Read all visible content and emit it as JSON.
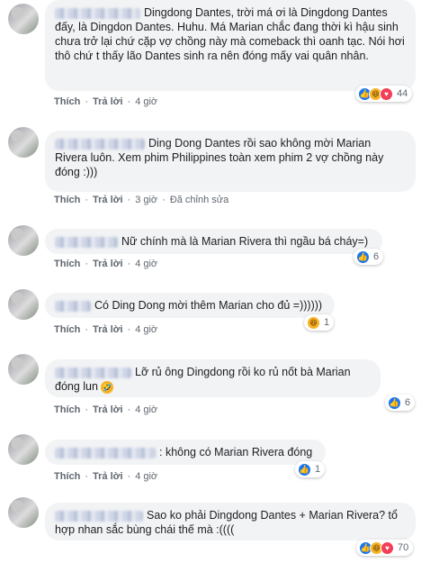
{
  "comments": [
    {
      "text": "Dingdong Dantes, trời má ơi là Dingdong Dantes đấy, là Dingdon Dantes. Huhu. Má Marian chắc đang thời kì hậu sinh chưa trở lại chứ cặp vợ chồng này mà comeback thì oanh tạc. Nói hơi thô chứ t thấy lão Dantes sinh ra nên đóng mấy vai quân nhân.",
      "like": "Thích",
      "reply": "Trả lời",
      "time": "4 giờ",
      "edited": "",
      "reactions": [
        "like-icon",
        "haha-icon",
        "love-icon"
      ],
      "reaction_count": "44"
    },
    {
      "text": "Ding Dong Dantes rồi sao không mời Marian Rivera luôn. Xem phim Philippines toàn xem phim 2 vợ chồng này đóng :)))",
      "like": "Thích",
      "reply": "Trả lời",
      "time": "3 giờ",
      "edited": "Đã chỉnh sửa",
      "reactions": [],
      "reaction_count": ""
    },
    {
      "text": "Nữ chính mà là Marian Rivera thì ngầu bá cháy=)",
      "like": "Thích",
      "reply": "Trả lời",
      "time": "4 giờ",
      "edited": "",
      "reactions": [
        "like-icon"
      ],
      "reaction_count": "6"
    },
    {
      "text": "Có Ding Dong mời thêm Marian cho đủ =))))))",
      "like": "Thích",
      "reply": "Trả lời",
      "time": "4 giờ",
      "edited": "",
      "reactions": [
        "haha-icon"
      ],
      "reaction_count": "1"
    },
    {
      "text": "Lỡ rủ ông Dingdong rồi ko rủ nốt bà Marian đóng lun",
      "like": "Thích",
      "reply": "Trả lời",
      "time": "4 giờ",
      "edited": "",
      "reactions": [
        "like-icon"
      ],
      "reaction_count": "6"
    },
    {
      "text": ": không có Marian Rivera đóng",
      "like": "Thích",
      "reply": "Trả lời",
      "time": "4 giờ",
      "edited": "",
      "reactions": [
        "like-icon"
      ],
      "reaction_count": "1"
    },
    {
      "text": "Sao ko phải Dingdong Dantes + Marian Rivera? tổ hợp nhan sắc bùng chái thế mà :((((",
      "like": "Thích",
      "reply": "Trả lời",
      "time": "4 giờ",
      "edited": "",
      "reactions": [
        "like-icon",
        "haha-icon",
        "love-icon"
      ],
      "reaction_count": "70"
    }
  ],
  "more_options_label": "···"
}
